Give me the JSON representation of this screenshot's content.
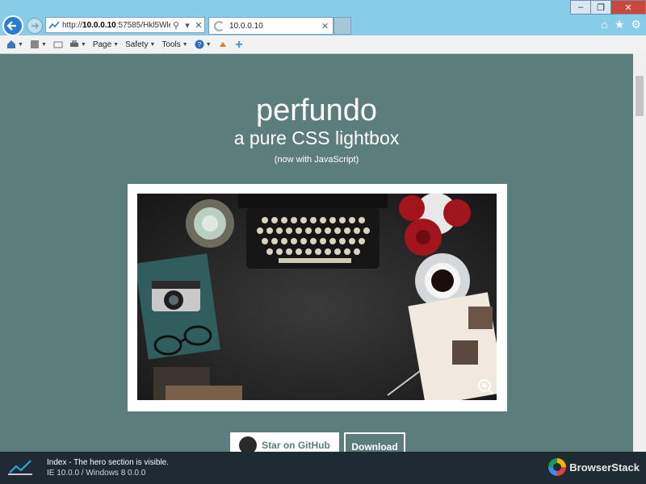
{
  "browser": {
    "address_prefix": "http://",
    "address_host": "10.0.0.10",
    "address_rest": ":57585/Hkl5WleYY",
    "tab_title": "10.0.0.10",
    "window_buttons": [
      "–",
      "❐",
      "✕"
    ]
  },
  "toolbar": {
    "page_label": "Page",
    "safety_label": "Safety",
    "tools_label": "Tools"
  },
  "hero": {
    "title": "perfundo",
    "subtitle": "a pure CSS lightbox",
    "note": "(now with JavaScript)"
  },
  "actions": {
    "github_label": "Star on GitHub",
    "download_label": "Download"
  },
  "status": {
    "line1": "Index - The hero section is visible.",
    "line2": "IE 10.0.0 / Windows 8 0.0.0",
    "brand": "BrowserStack"
  },
  "colors": {
    "page_bg": "#5b7d7c",
    "chrome_bg": "#87cde8",
    "status_bg": "#1f2b33"
  }
}
